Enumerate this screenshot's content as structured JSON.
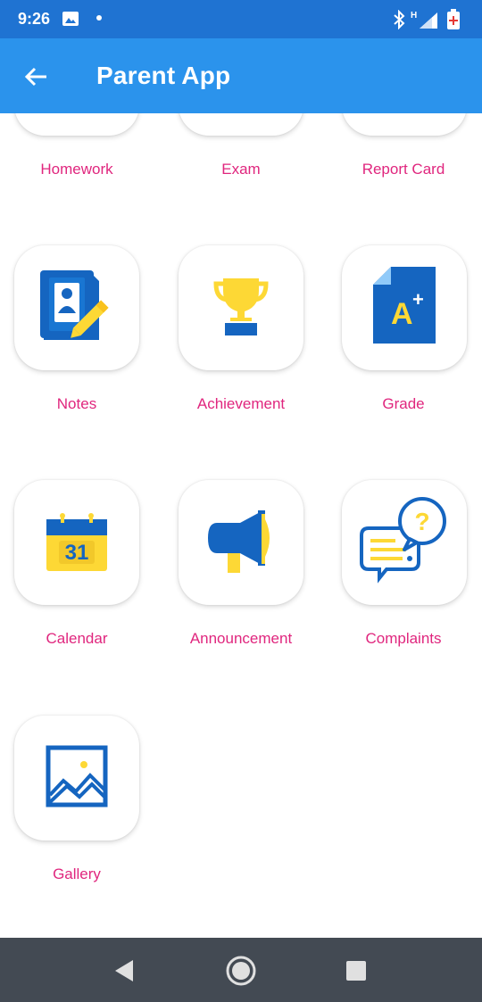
{
  "status": {
    "time": "9:26",
    "icons": [
      "image-icon",
      "dot-icon",
      "bluetooth-icon",
      "signal-h-icon",
      "battery-icon"
    ]
  },
  "app_bar": {
    "title": "Parent App",
    "back_icon": "arrow-left-icon"
  },
  "menu": [
    {
      "label": "Homework",
      "icon": "homework-icon"
    },
    {
      "label": "Exam",
      "icon": "exam-icon"
    },
    {
      "label": "Report Card",
      "icon": "report-card-icon"
    },
    {
      "label": "Notes",
      "icon": "notes-icon"
    },
    {
      "label": "Achievement",
      "icon": "trophy-icon"
    },
    {
      "label": "Grade",
      "icon": "grade-icon"
    },
    {
      "label": "Calendar",
      "icon": "calendar-icon"
    },
    {
      "label": "Announcement",
      "icon": "megaphone-icon"
    },
    {
      "label": "Complaints",
      "icon": "chat-bubbles-icon"
    },
    {
      "label": "Gallery",
      "icon": "gallery-icon"
    }
  ],
  "icon_text": {
    "grade": "A",
    "grade_plus": "+",
    "calendar_day": "31",
    "complaint_mark": "?"
  },
  "nav": [
    "back-triangle-icon",
    "home-circle-icon",
    "recents-square-icon"
  ],
  "colors": {
    "status_bar": "#1f73d2",
    "app_bar": "#2b93ec",
    "label": "#e0267e",
    "icon_blue": "#1565c0",
    "icon_yellow": "#fdd835",
    "nav_bar": "#434a53"
  }
}
